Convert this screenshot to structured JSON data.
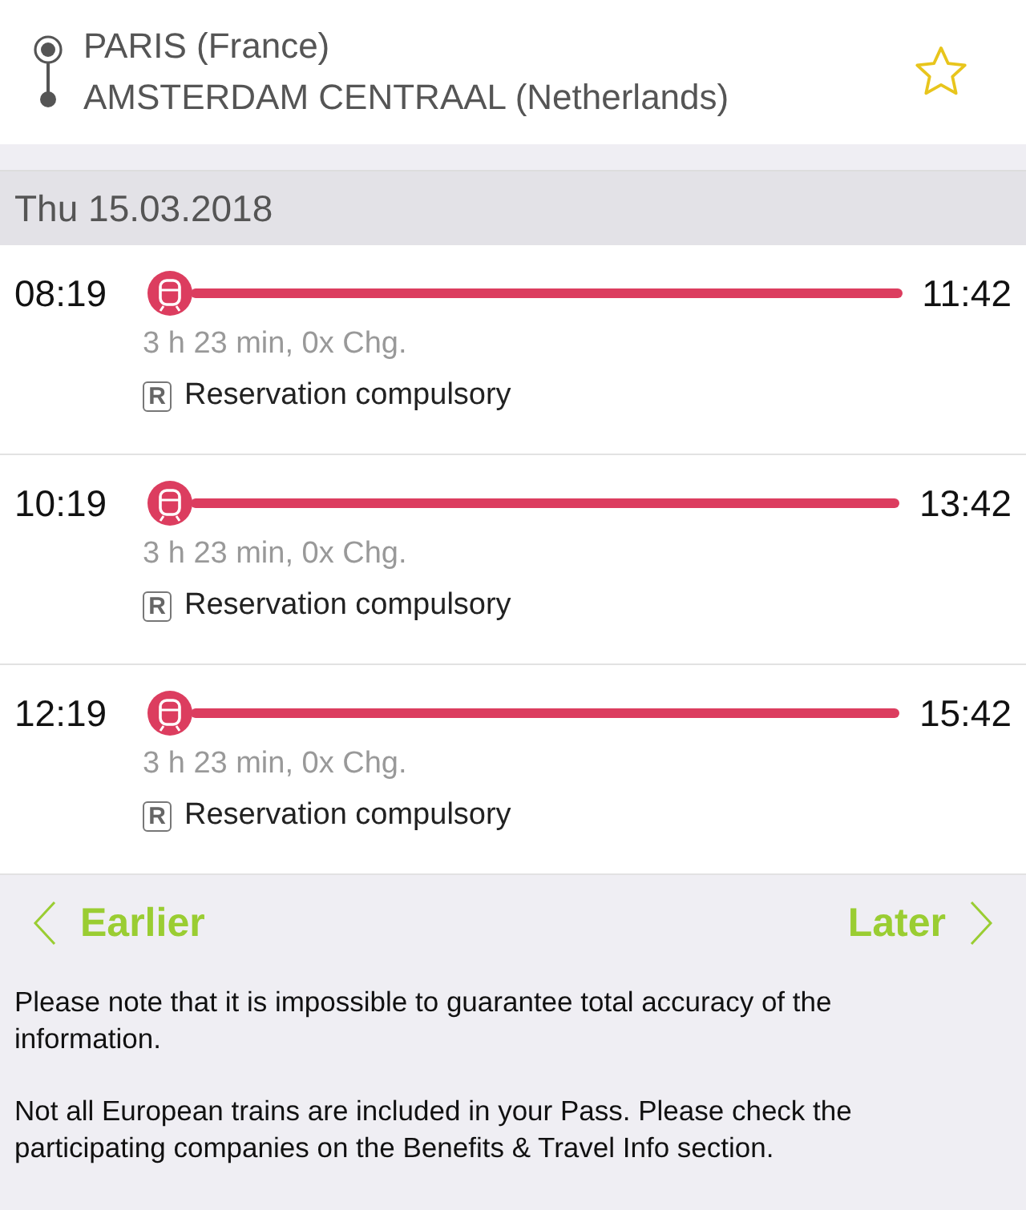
{
  "route": {
    "from": "PARIS (France)",
    "to": "AMSTERDAM CENTRAAL (Netherlands)"
  },
  "date": "Thu 15.03.2018",
  "connections": [
    {
      "departure": "08:19",
      "arrival": "11:42",
      "duration": "3 h 23 min, 0x Chg.",
      "badge": "R",
      "note": "Reservation compulsory"
    },
    {
      "departure": "10:19",
      "arrival": "13:42",
      "duration": "3 h 23 min, 0x Chg.",
      "badge": "R",
      "note": "Reservation compulsory"
    },
    {
      "departure": "12:19",
      "arrival": "15:42",
      "duration": "3 h 23 min, 0x Chg.",
      "badge": "R",
      "note": "Reservation compulsory"
    }
  ],
  "navigation": {
    "earlier": "Earlier",
    "later": "Later"
  },
  "notes": [
    "Please note that it is impossible to guarantee total accuracy of the information.",
    "Not all European trains are included in your Pass. Please check the participating companies on the Benefits & Travel Info section."
  ]
}
